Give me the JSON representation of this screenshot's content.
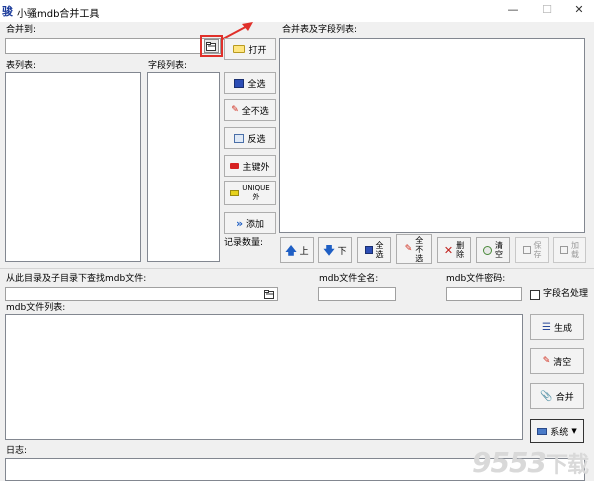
{
  "window": {
    "icon_text": "骏",
    "title": "小骚mdb合并工具",
    "minimize": "—",
    "maximize": "☐",
    "close": "✕"
  },
  "merge_to": {
    "label": "合并到:",
    "value": "",
    "browse_icon": "folder-open-icon"
  },
  "table_list": {
    "label": "表列表:"
  },
  "field_list": {
    "label": "字段列表:"
  },
  "merged_list": {
    "label": "合并表及字段列表:"
  },
  "middle_buttons": {
    "open": "打开",
    "select_all": "全选",
    "select_none": "全不选",
    "invert": "反选",
    "primary_key": "主键外",
    "unique_line1": "UNIQUE",
    "unique_line2": "外",
    "add": "添加"
  },
  "record_count": {
    "label": "记录数量:"
  },
  "bottom_toolbar": {
    "up": "上",
    "down": "下",
    "select_all_1": "全",
    "select_all_2": "选",
    "select_none_1": "全",
    "select_none_2": "不",
    "select_none_3": "选",
    "delete_1": "删",
    "delete_2": "除",
    "clear_1": "清",
    "clear_2": "空",
    "save_1": "保",
    "save_2": "存",
    "load_1": "加",
    "load_2": "载"
  },
  "search_dir": {
    "label": "从此目录及子目录下查找mdb文件:",
    "value": ""
  },
  "mdb_fullname": {
    "label": "mdb文件全名:",
    "value": ""
  },
  "mdb_password": {
    "label": "mdb文件密码:",
    "value": ""
  },
  "field_name_handling": {
    "label": "字段名处理",
    "checked": false
  },
  "mdb_file_list": {
    "label": "mdb文件列表:"
  },
  "side_buttons": {
    "generate": "生成",
    "clear": "清空",
    "merge": "合并",
    "system": "系统"
  },
  "log": {
    "label": "日志:"
  },
  "watermark": {
    "main": "9553",
    "suffix": "下载"
  },
  "colors": {
    "highlight": "#e0302a",
    "arrow_blue": "#1f5fc4",
    "delete_red": "#c0201c"
  }
}
